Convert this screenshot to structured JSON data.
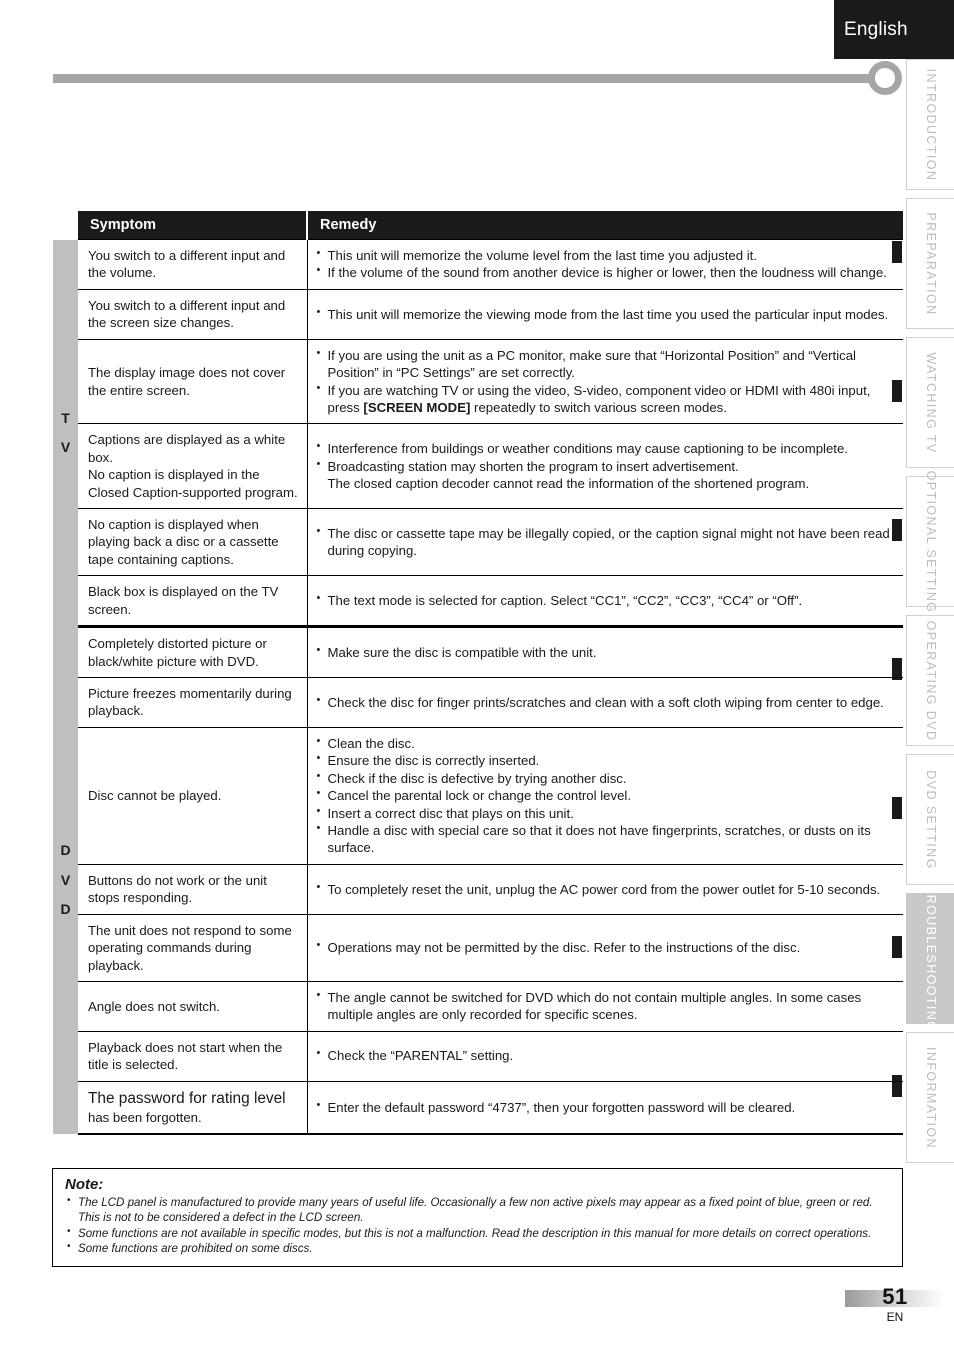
{
  "header": {
    "language_label": "English"
  },
  "side_tabs": [
    {
      "label": "INTRODUCTION",
      "active": false
    },
    {
      "label": "PREPARATION",
      "active": false
    },
    {
      "label": "WATCHING  TV",
      "active": false
    },
    {
      "label": "OPTIONAL  SETTING",
      "active": false
    },
    {
      "label": "OPERATING  DVD",
      "active": false
    },
    {
      "label": "DVD  SETTING",
      "active": false
    },
    {
      "label": "TROUBLESHOOTING",
      "active": true
    },
    {
      "label": "INFORMATION",
      "active": false
    }
  ],
  "table": {
    "headers": {
      "symptom": "Symptom",
      "remedy": "Remedy"
    },
    "groups": [
      {
        "id": "tv",
        "letters": [
          "T",
          "V"
        ]
      },
      {
        "id": "dvd",
        "letters": [
          "D",
          "V",
          "D"
        ]
      }
    ],
    "rows": [
      {
        "symptom": "You switch to a different input and the volume.",
        "remedies": [
          "This unit will memorize the volume level from the last time you adjusted it.",
          "If the volume of the sound from another device is higher or lower, then the loudness will change."
        ]
      },
      {
        "symptom": "You switch to a different input and the screen size changes.",
        "remedies": [
          "This unit will memorize the viewing mode from the last time you used the particular input modes."
        ]
      },
      {
        "symptom": "The display image does not cover the entire screen.",
        "remedies_rich": [
          {
            "pre": "If you are using the unit as a PC monitor, make sure that “Horizontal Position” and “Vertical Position” in “PC Settings” are set correctly.",
            "bold": "",
            "post": ""
          },
          {
            "pre": "If you are watching TV or using the video, S-video, component video or HDMI with 480i input, press ",
            "bold": "[SCREEN MODE]",
            "post": " repeatedly to switch various screen modes."
          }
        ]
      },
      {
        "symptom": "Captions are displayed as a white box.\nNo caption is displayed in the Closed Caption-supported program.",
        "remedies": [
          "Interference from buildings or weather conditions may cause captioning to be incomplete.",
          "Broadcasting station may shorten the program to insert advertisement.\nThe closed caption decoder cannot read the information of the shortened program."
        ]
      },
      {
        "symptom": "No caption is displayed when playing back a disc or a cassette tape containing captions.",
        "remedies": [
          "The disc or cassette tape may be illegally copied, or the caption signal might not have been read during copying."
        ]
      },
      {
        "symptom": "Black box is displayed on the TV screen.",
        "remedies": [
          "The text mode is selected for caption. Select “CC1”, “CC2”, “CC3”, “CC4” or “Off”."
        ]
      },
      {
        "symptom": "Completely distorted picture or black/white picture with DVD.",
        "remedies": [
          "Make sure the disc is compatible with the unit."
        ]
      },
      {
        "symptom": "Picture freezes momentarily during playback.",
        "remedies": [
          "Check the disc for finger prints/scratches and clean with a soft cloth wiping from center to edge."
        ]
      },
      {
        "symptom": "Disc cannot be played.",
        "remedies": [
          "Clean the disc.",
          "Ensure the disc is correctly inserted.",
          "Check if the disc is defective by trying another disc.",
          "Cancel the parental lock or change the control level.",
          "Insert a correct disc that plays on this unit.",
          "Handle a disc with special care so that it does not have fingerprints, scratches, or dusts on its surface."
        ]
      },
      {
        "symptom": "Buttons do not work or the unit stops responding.",
        "remedies": [
          "To completely reset the unit, unplug the AC power cord from the power outlet for 5-10 seconds."
        ]
      },
      {
        "symptom": "The unit does not respond to some operating commands during playback.",
        "remedies": [
          "Operations may not be permitted by the disc. Refer to the instructions of the disc."
        ]
      },
      {
        "symptom": "Angle does not switch.",
        "remedies": [
          "The angle cannot be switched for DVD which do not contain multiple angles. In some cases multiple angles are only recorded for specific scenes."
        ]
      },
      {
        "symptom": "Playback does not start when the title is selected.",
        "remedies": [
          "Check the “PARENTAL” setting."
        ]
      },
      {
        "symptom_part1": "The password for rating level",
        "symptom_part2": "has been forgotten.",
        "remedies": [
          "Enter the default password “4737”, then your forgotten password will be cleared."
        ]
      }
    ]
  },
  "note": {
    "title": "Note:",
    "items": [
      "The LCD panel is manufactured to provide many years of useful life. Occasionally a few non active pixels may appear as a fixed point of blue, green or red. This is not to be considered a defect in the LCD screen.",
      "Some functions are not available in specific modes, but this is not a malfunction. Read the description in this manual  for more details on correct operations.",
      "Some functions are prohibited on some discs."
    ]
  },
  "footer": {
    "page_number": "51",
    "language_code": "EN"
  },
  "colors": {
    "header_black": "#1a1a1a",
    "group_gray": "#bfbfbf",
    "rule_gray": "#a6a6a6",
    "tab_text_gray": "#bdbdbd",
    "active_tab_gray": "#c9c9c9"
  }
}
